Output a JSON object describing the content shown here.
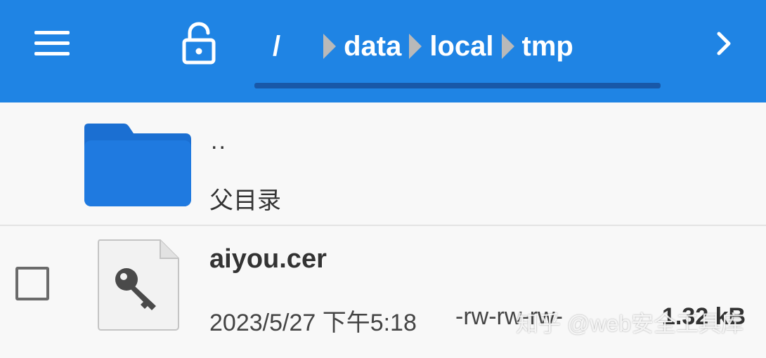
{
  "colors": {
    "toolbar": "#1f84e4",
    "underline": "#1858a8",
    "folder": "#1b6fd2",
    "crumb_separator": "#b9b9b9"
  },
  "toolbar": {
    "menu_icon": "hamburger-menu-icon",
    "lock_icon": "unlocked-padlock-icon",
    "next_icon": "chevron-right-icon",
    "breadcrumb": {
      "root": "/",
      "segments": [
        "data",
        "local",
        "tmp"
      ]
    }
  },
  "files": {
    "parent": {
      "name": "..",
      "subtitle": "父目录",
      "icon": "folder-icon"
    },
    "items": [
      {
        "name": "aiyou.cer",
        "date": "2023/5/27 下午5:18",
        "permissions": "-rw-rw-rw-",
        "size": "1.32 kB",
        "icon": "key-file-icon",
        "checked": false
      }
    ]
  },
  "watermark": "知乎 @web安全工具库"
}
